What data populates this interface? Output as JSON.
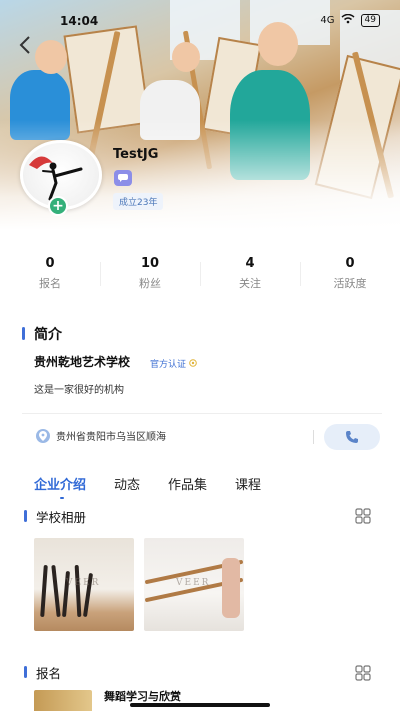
{
  "status_bar": {
    "time": "14:04",
    "signal": "4G",
    "battery": "49"
  },
  "profile": {
    "name": "TestJG",
    "age_badge": "成立23年"
  },
  "stats": [
    {
      "value": "0",
      "label": "报名"
    },
    {
      "value": "10",
      "label": "粉丝"
    },
    {
      "value": "4",
      "label": "关注"
    },
    {
      "value": "0",
      "label": "活跃度"
    }
  ],
  "intro": {
    "section_title": "简介",
    "school_name": "贵州乾地艺术学校",
    "verified_label": "官方认证",
    "description": "这是一家很好的机构",
    "address": "贵州省贵阳市乌当区顺海"
  },
  "tabs": [
    {
      "label": "企业介绍",
      "active": true
    },
    {
      "label": "动态",
      "active": false
    },
    {
      "label": "作品集",
      "active": false
    },
    {
      "label": "课程",
      "active": false
    }
  ],
  "album": {
    "title": "学校相册",
    "photos": [
      {
        "watermark": "VEER"
      },
      {
        "watermark": "VEER"
      }
    ]
  },
  "signup": {
    "title": "报名",
    "first_course": "舞蹈学习与欣赏"
  },
  "colors": {
    "accent": "#3069d6",
    "plus_green": "#34b07a",
    "message_purple": "#8c8ee8"
  }
}
